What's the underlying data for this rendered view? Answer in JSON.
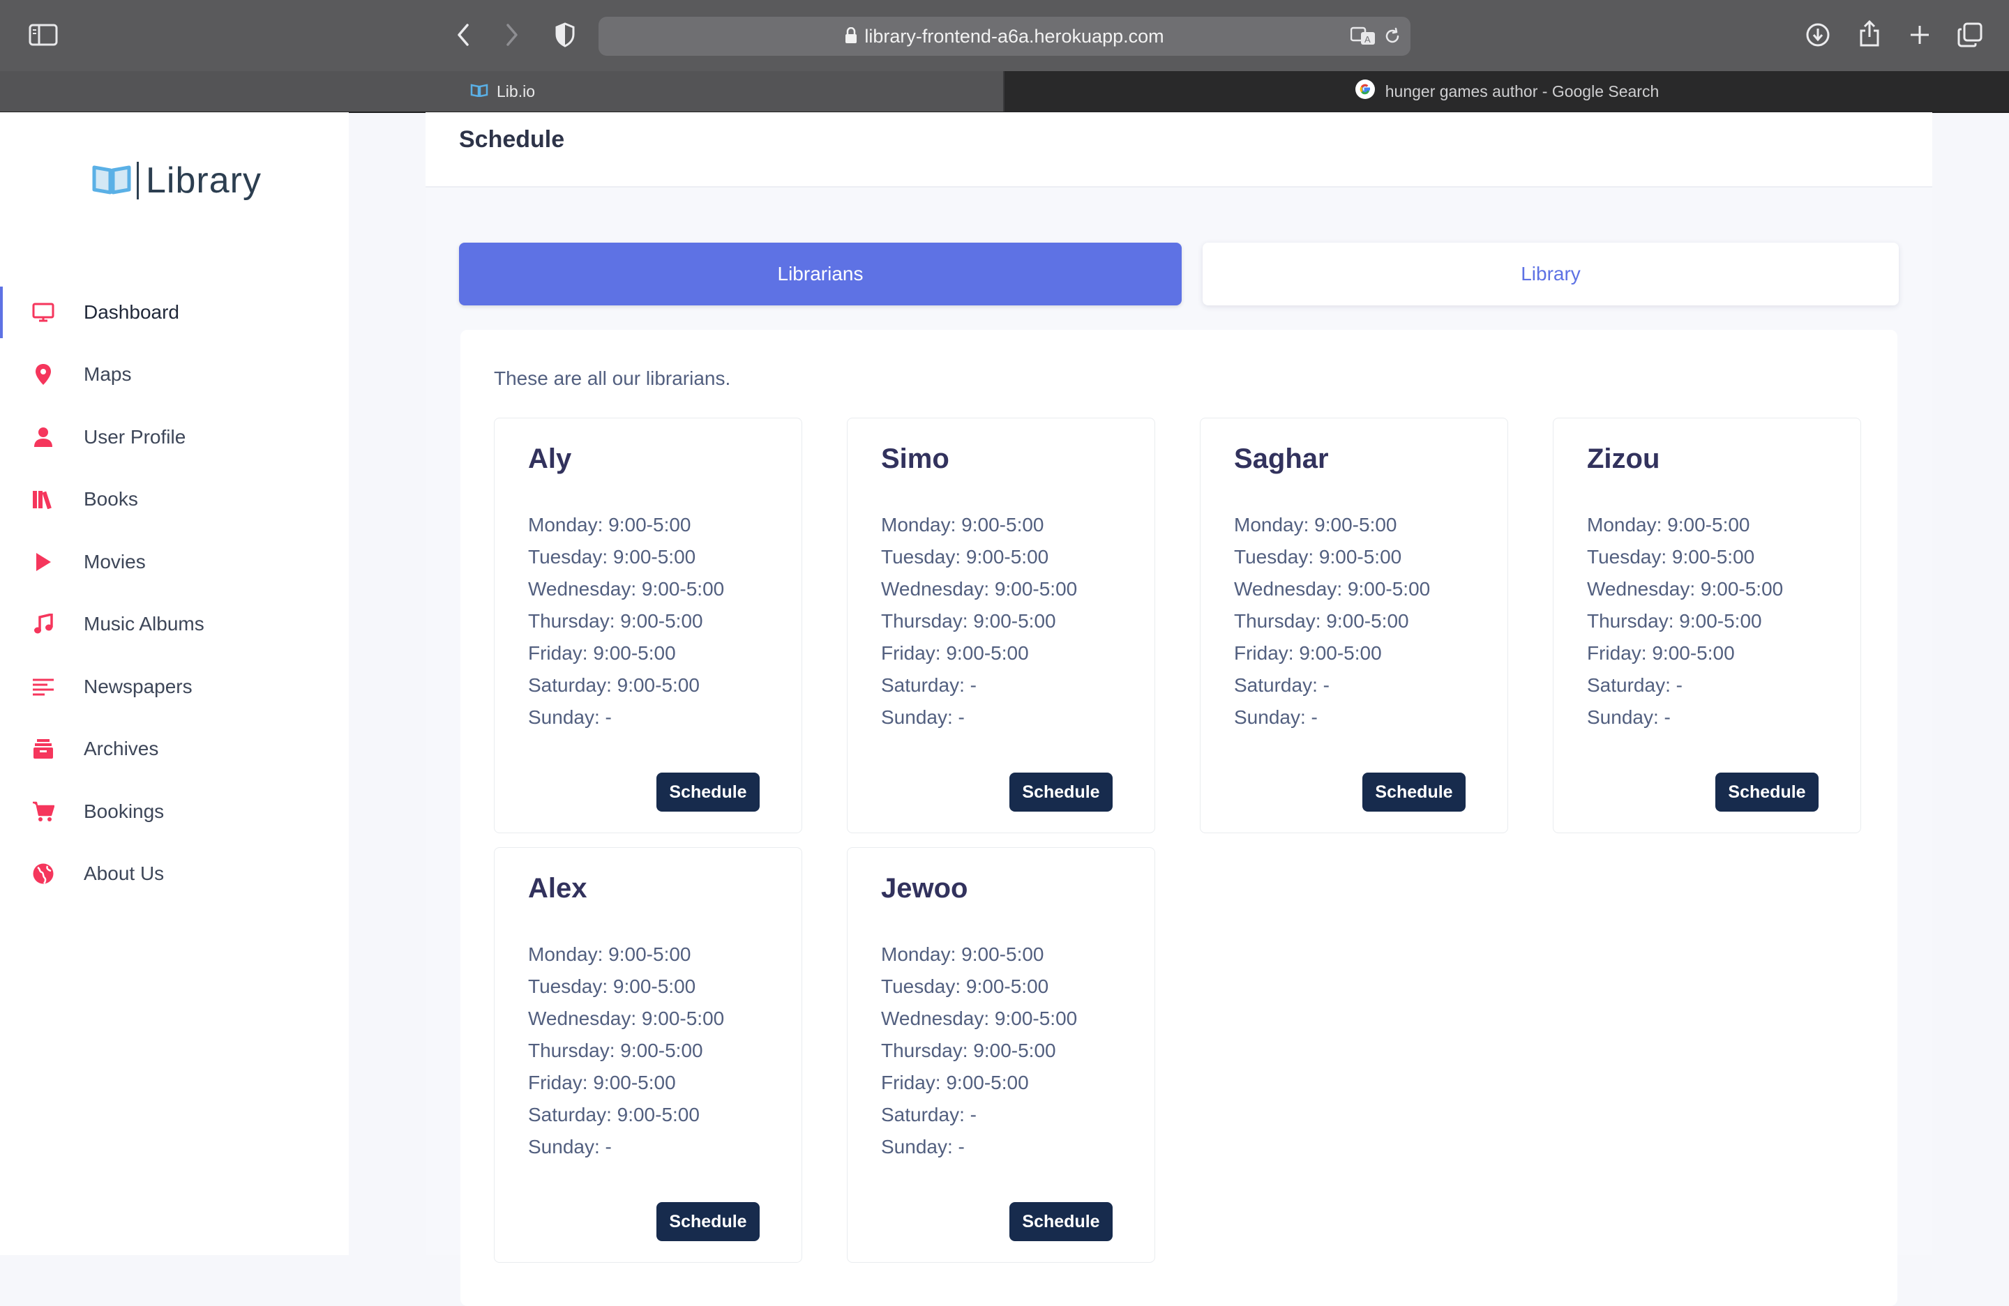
{
  "browser": {
    "url": "library-frontend-a6a.herokuapp.com",
    "tabs": [
      {
        "label": "Lib.io",
        "active": true
      },
      {
        "label": "hunger games author - Google Search",
        "active": false
      }
    ]
  },
  "sidebar": {
    "logo_text": "Library",
    "accent_color": "#f5365c",
    "items": [
      {
        "label": "Dashboard",
        "icon": "monitor-icon",
        "active": true
      },
      {
        "label": "Maps",
        "icon": "map-pin-icon"
      },
      {
        "label": "User Profile",
        "icon": "user-icon"
      },
      {
        "label": "Books",
        "icon": "books-icon"
      },
      {
        "label": "Movies",
        "icon": "play-icon"
      },
      {
        "label": "Music Albums",
        "icon": "music-note-icon"
      },
      {
        "label": "Newspapers",
        "icon": "align-left-icon"
      },
      {
        "label": "Archives",
        "icon": "archive-icon"
      },
      {
        "label": "Bookings",
        "icon": "cart-icon"
      },
      {
        "label": "About Us",
        "icon": "globe-icon"
      }
    ]
  },
  "main": {
    "title": "Schedule",
    "tabs": [
      {
        "label": "Librarians",
        "active": true
      },
      {
        "label": "Library",
        "active": false
      }
    ],
    "intro": "These are all our librarians.",
    "schedule_button_label": "Schedule",
    "librarians": [
      {
        "name": "Aly",
        "hours": [
          "Monday: 9:00-5:00",
          "Tuesday: 9:00-5:00",
          "Wednesday: 9:00-5:00",
          "Thursday: 9:00-5:00",
          "Friday: 9:00-5:00",
          "Saturday: 9:00-5:00",
          "Sunday: -"
        ]
      },
      {
        "name": "Simo",
        "hours": [
          "Monday: 9:00-5:00",
          "Tuesday: 9:00-5:00",
          "Wednesday: 9:00-5:00",
          "Thursday: 9:00-5:00",
          "Friday: 9:00-5:00",
          "Saturday: -",
          "Sunday: -"
        ]
      },
      {
        "name": "Saghar",
        "hours": [
          "Monday: 9:00-5:00",
          "Tuesday: 9:00-5:00",
          "Wednesday: 9:00-5:00",
          "Thursday: 9:00-5:00",
          "Friday: 9:00-5:00",
          "Saturday: -",
          "Sunday: -"
        ]
      },
      {
        "name": "Zizou",
        "hours": [
          "Monday: 9:00-5:00",
          "Tuesday: 9:00-5:00",
          "Wednesday: 9:00-5:00",
          "Thursday: 9:00-5:00",
          "Friday: 9:00-5:00",
          "Saturday: -",
          "Sunday: -"
        ]
      },
      {
        "name": "Alex",
        "hours": [
          "Monday: 9:00-5:00",
          "Tuesday: 9:00-5:00",
          "Wednesday: 9:00-5:00",
          "Thursday: 9:00-5:00",
          "Friday: 9:00-5:00",
          "Saturday: 9:00-5:00",
          "Sunday: -"
        ]
      },
      {
        "name": "Jewoo",
        "hours": [
          "Monday: 9:00-5:00",
          "Tuesday: 9:00-5:00",
          "Wednesday: 9:00-5:00",
          "Thursday: 9:00-5:00",
          "Friday: 9:00-5:00",
          "Saturday: -",
          "Sunday: -"
        ]
      }
    ]
  }
}
